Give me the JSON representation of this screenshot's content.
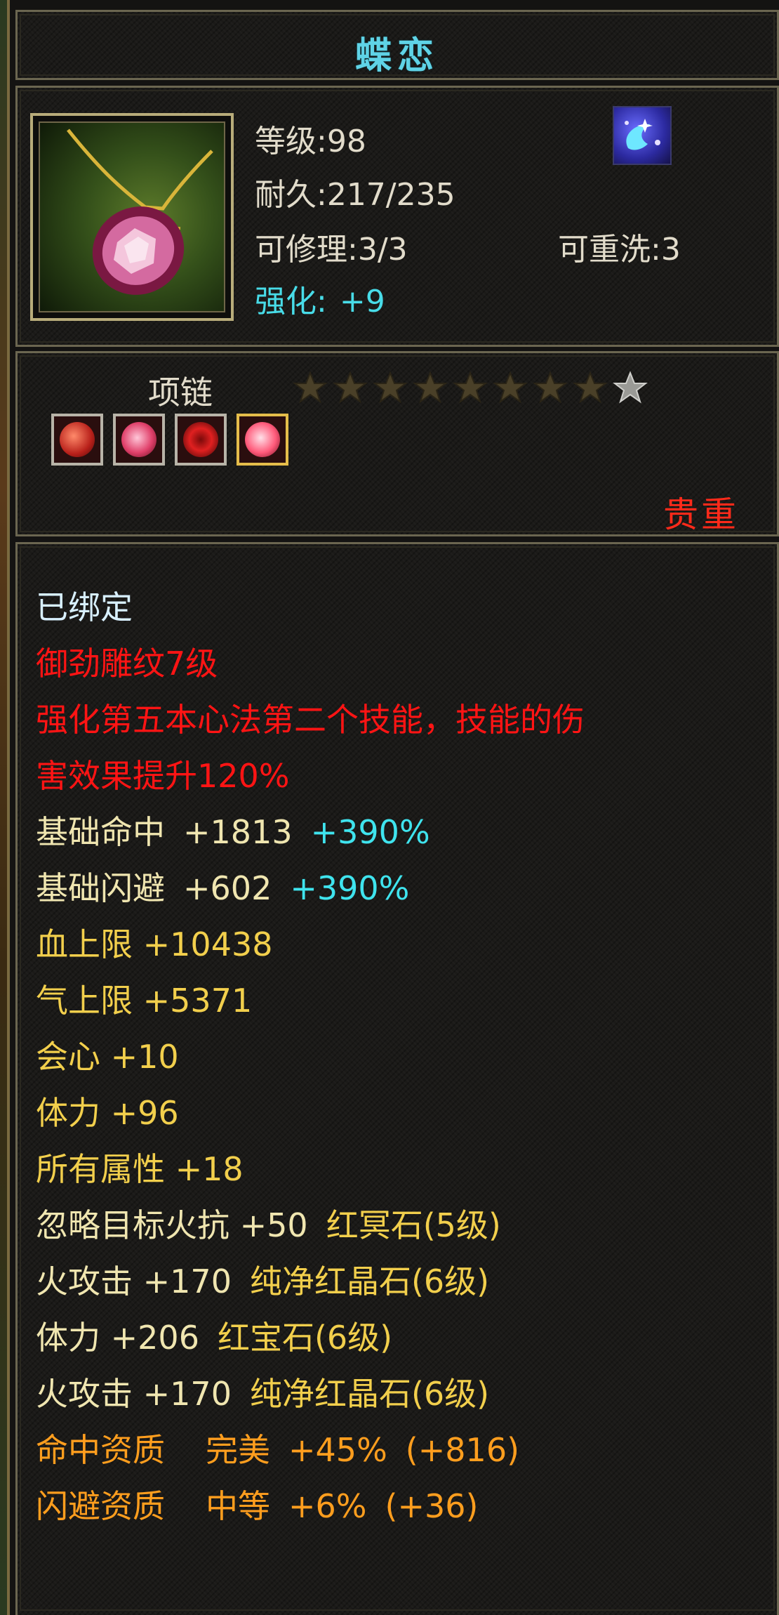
{
  "item": {
    "name": "蝶恋",
    "level": "等级:98",
    "durability": "耐久:217/235",
    "repairable": "可修理:3/3",
    "rewashable": "可重洗:3",
    "refine_label": "强化:",
    "refine_value": "+9",
    "type": "项链",
    "star_count": 9,
    "star_filled": 8,
    "rarity": "贵重",
    "gems": [
      "red-gem-icon",
      "red-gem-icon",
      "red-gem-icon",
      "red-gem-icon"
    ]
  },
  "attributes": {
    "bound": "已绑定",
    "engraving": "御劲雕纹7级",
    "skill_effect_1": "强化第五本心法第二个技能，技能的伤",
    "skill_effect_2": "害效果提升120%",
    "hit": {
      "name": "基础命中",
      "value": "+1813",
      "bonus": "+390%"
    },
    "dodge": {
      "name": "基础闪避",
      "value": "+602",
      "bonus": "+390%"
    },
    "hp": "血上限 +10438",
    "mp": "气上限 +5371",
    "crit": "会心 +10",
    "stamina": "体力 +96",
    "all_attr": "所有属性 +18",
    "gem_lines": [
      {
        "stat": "忽略目标火抗 +50",
        "gem": "红冥石(5级)"
      },
      {
        "stat": "火攻击 +170",
        "gem": "纯净红晶石(6级)"
      },
      {
        "stat": "体力 +206",
        "gem": "红宝石(6级)"
      },
      {
        "stat": "火攻击 +170",
        "gem": "纯净红晶石(6级)"
      }
    ],
    "hit_aptitude": {
      "name": "命中资质",
      "grade": "完美",
      "value": "+45%",
      "extra": "(+816)"
    },
    "dodge_aptitude": {
      "name": "闪避资质",
      "grade": "中等",
      "value": "+6%",
      "extra": "(+36)"
    }
  },
  "colors": {
    "title": "#5fd3e6",
    "rarity": "#ff2a1a",
    "effect_red": "#ff1414",
    "bonus_cyan": "#3fe4ee",
    "stat_gold": "#f2cf4c",
    "aptitude_orange": "#ff9e1e"
  }
}
